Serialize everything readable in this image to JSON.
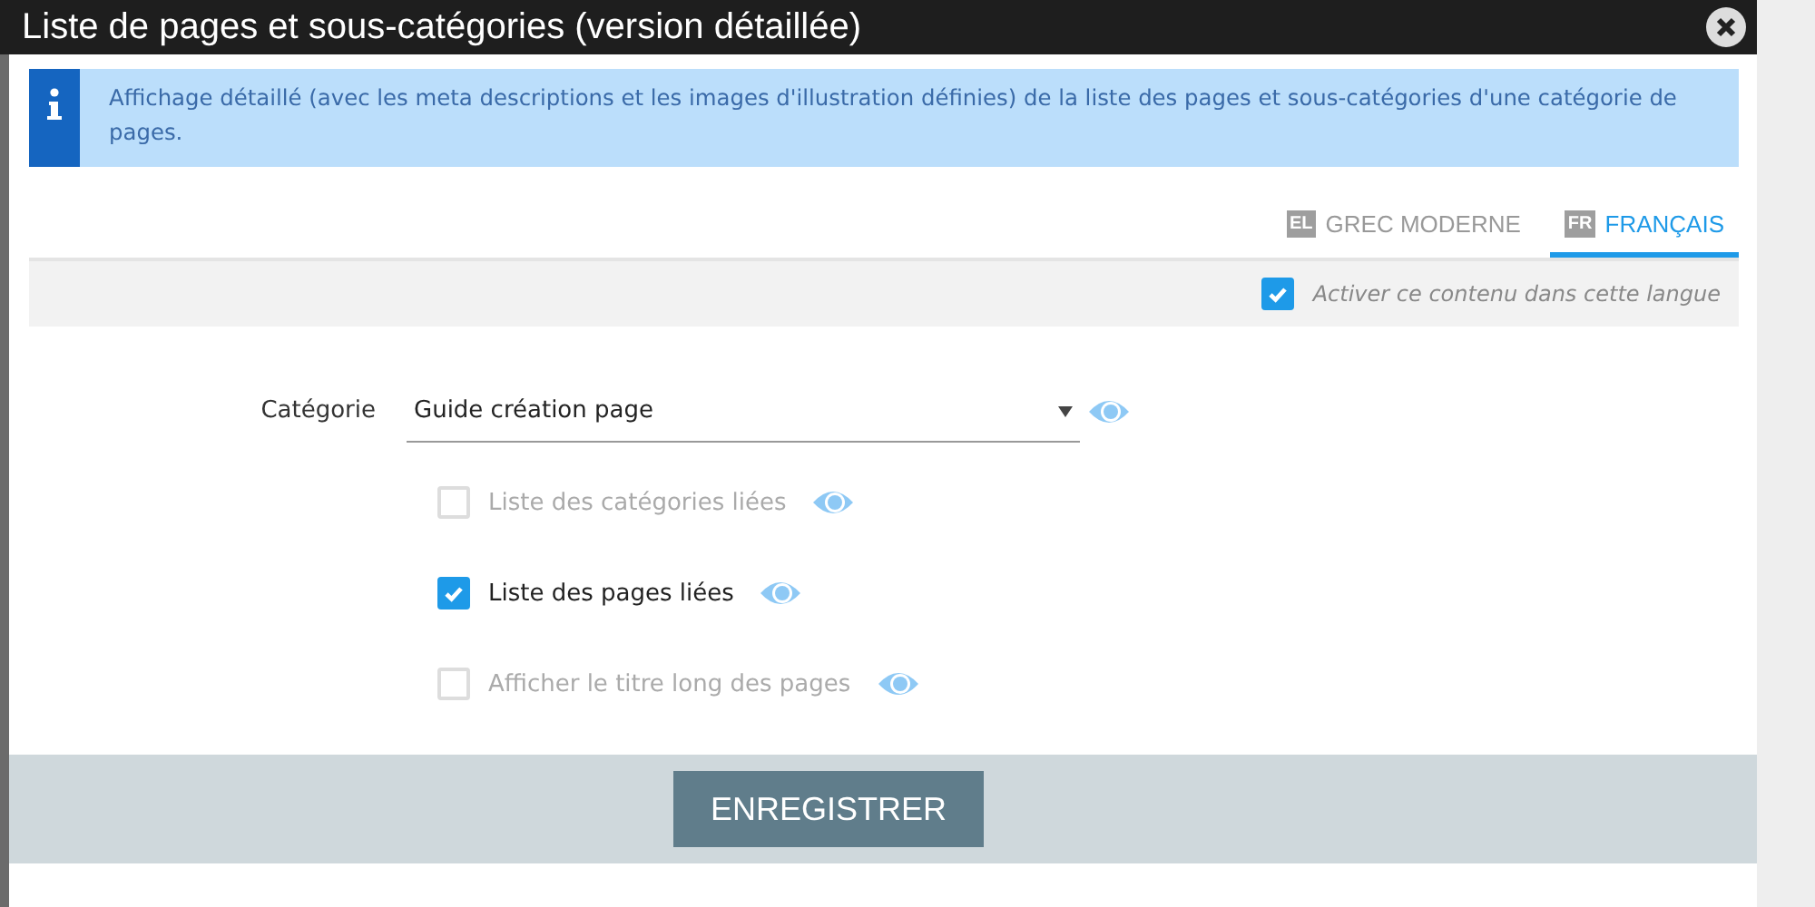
{
  "dialog": {
    "title": "Liste de pages et sous-catégories (version détaillée)"
  },
  "info": "Affichage détaillé (avec les meta descriptions et les images d'illustration définies) de la liste des pages et sous-catégories d'une catégorie de pages.",
  "tabs": [
    {
      "code": "EL",
      "label": "GREC MODERNE",
      "selected": false
    },
    {
      "code": "FR",
      "label": "FRANÇAIS",
      "selected": true
    }
  ],
  "language_toggle": {
    "label": "Activer ce contenu dans cette langue",
    "checked": true
  },
  "category": {
    "label": "Catégorie",
    "value": "Guide création page"
  },
  "options": [
    {
      "label": "Liste des catégories liées",
      "checked": false,
      "disabled": true
    },
    {
      "label": "Liste des pages liées",
      "checked": true,
      "disabled": false
    },
    {
      "label": "Afficher le titre long des pages",
      "checked": false,
      "disabled": true
    }
  ],
  "save_button": "ENREGISTRER"
}
